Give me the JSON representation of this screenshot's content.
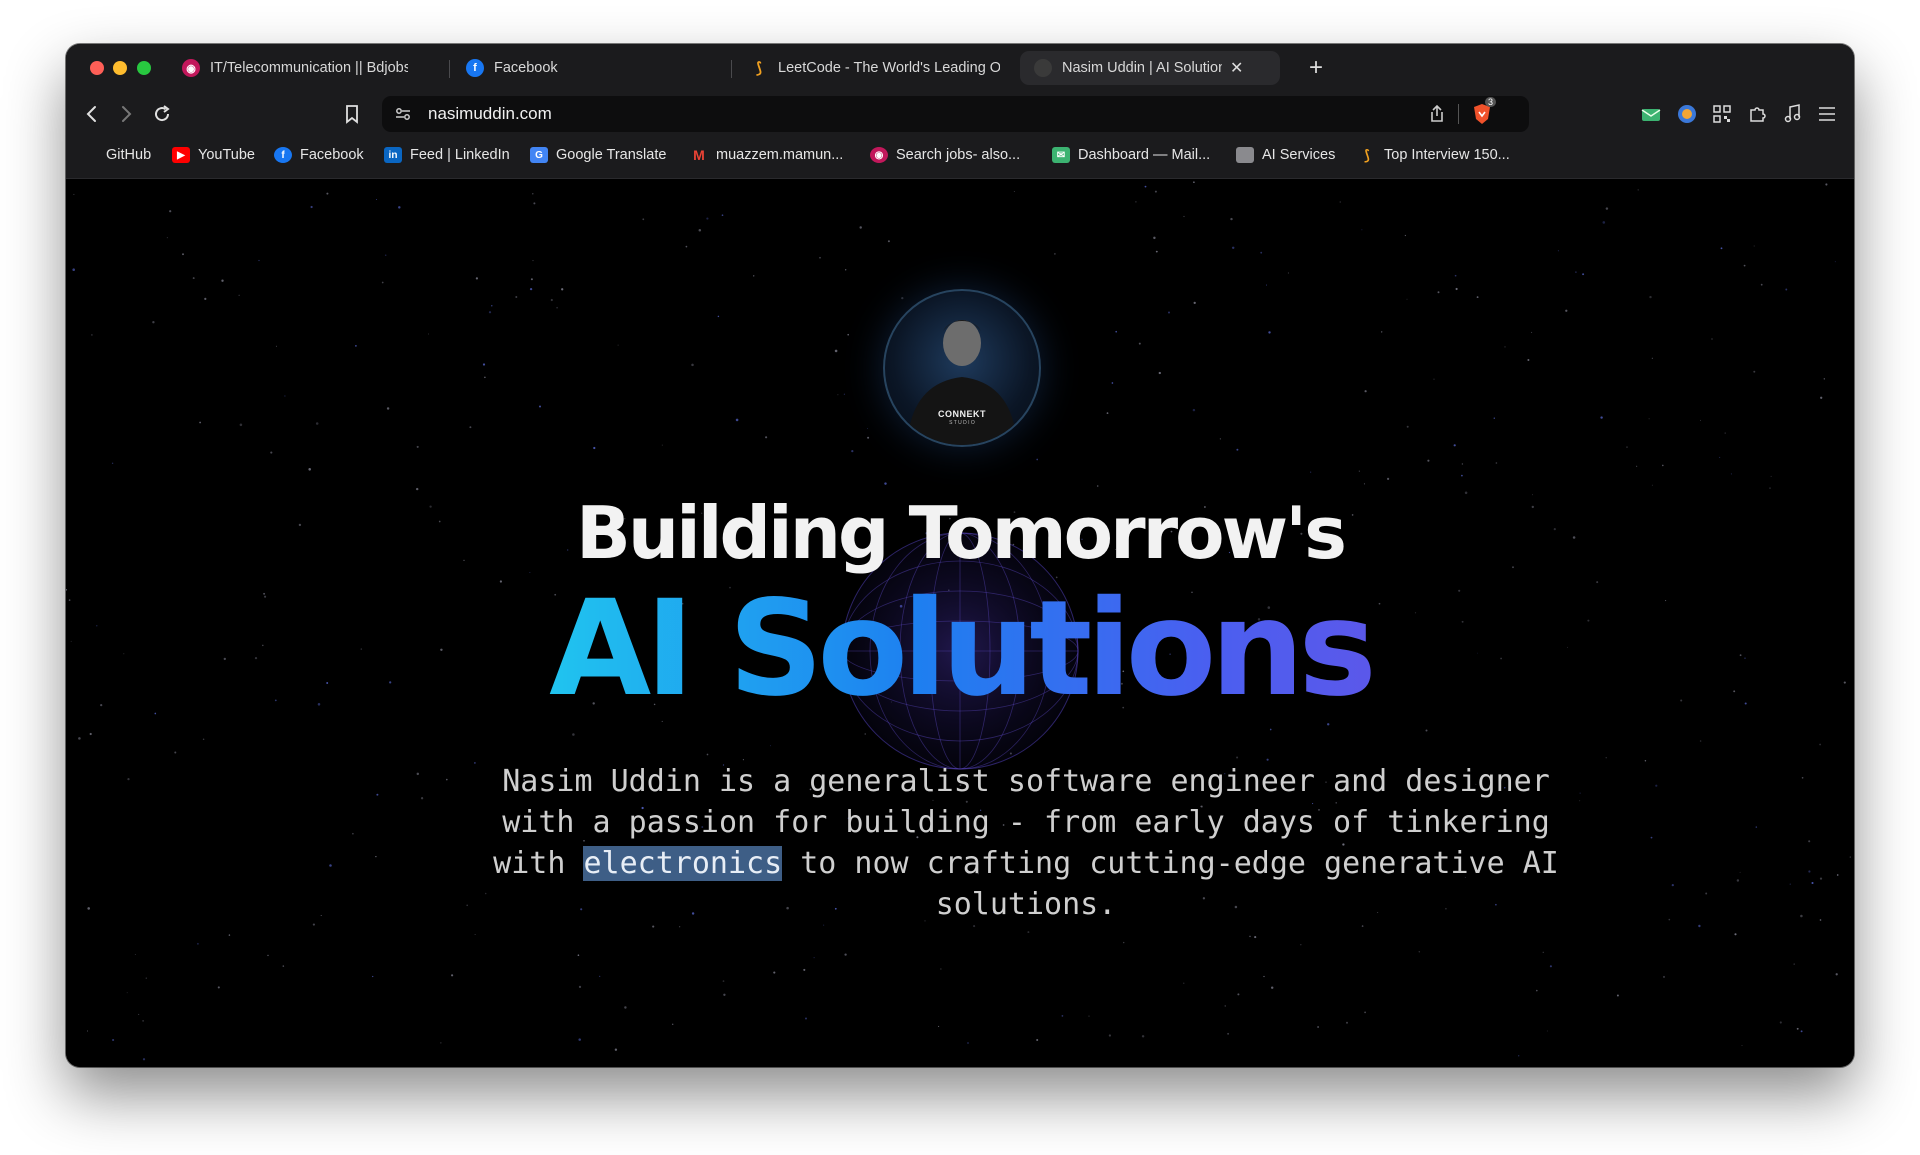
{
  "browser": {
    "tabs": [
      {
        "title": "IT/Telecommunication || Bdjobs.com",
        "icon": "bdjobs-icon"
      },
      {
        "title": "Facebook",
        "icon": "facebook-icon"
      },
      {
        "title": "LeetCode - The World's Leading Online Programming Learning Platform",
        "icon": "leetcode-icon"
      },
      {
        "title": "Nasim Uddin | AI Solutions Architect",
        "icon": "avatar-icon",
        "active": true
      }
    ],
    "url": "nasimuddin.com",
    "shield_badge": "3",
    "bookmarks": [
      {
        "label": "GitHub",
        "icon": "github-icon"
      },
      {
        "label": "YouTube",
        "icon": "youtube-icon"
      },
      {
        "label": "Facebook",
        "icon": "facebook-icon"
      },
      {
        "label": "Feed | LinkedIn",
        "icon": "linkedin-icon"
      },
      {
        "label": "Google Translate",
        "icon": "google-translate-icon"
      },
      {
        "label": "muazzem.mamun...",
        "icon": "gmail-icon"
      },
      {
        "label": "Search jobs- also...",
        "icon": "bdjobs-icon"
      },
      {
        "label": "Dashboard — Mail...",
        "icon": "mail-icon"
      },
      {
        "label": "AI Services",
        "icon": "folder-icon"
      },
      {
        "label": "Top Interview 150...",
        "icon": "leetcode-icon"
      }
    ]
  },
  "hero": {
    "avatar_text": "CONNEKT",
    "avatar_subtext": "S T U D I O",
    "headline_line1": "Building Tomorrow's",
    "headline_line2": "AI Solutions",
    "description_part1": "Nasim Uddin is a generalist software engineer and designer with a passion for building - from early days of tinkering with ",
    "description_selected": "electronics",
    "description_part2": " to now crafting cutting-edge generative AI solutions."
  },
  "colors": {
    "gradient_start": "#20c4ef",
    "gradient_mid": "#1e7ff0",
    "gradient_end": "#5b58ea",
    "selection": "#3e5e86"
  }
}
